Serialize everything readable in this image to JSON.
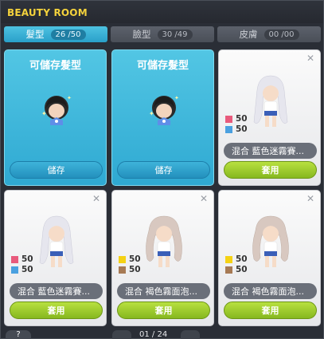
{
  "window": {
    "title": "BEAUTY ROOM"
  },
  "tabs": [
    {
      "label": "髮型",
      "count": "26 /50"
    },
    {
      "label": "臉型",
      "count": "30 /49"
    },
    {
      "label": "皮膚",
      "count": "00 /00"
    }
  ],
  "slots": [
    {
      "type": "save",
      "label": "可儲存髮型",
      "button": "儲存"
    },
    {
      "type": "save",
      "label": "可儲存髮型",
      "button": "儲存"
    },
    {
      "type": "style",
      "name": "混合  藍色迷霧賽...",
      "mix1": "50",
      "mix2": "50",
      "color1": "#e85a7c",
      "color2": "#4aa0e0",
      "hair": "#e6e6ee",
      "button": "套用"
    },
    {
      "type": "style",
      "name": "混合  藍色迷霧賽...",
      "mix1": "50",
      "mix2": "50",
      "color1": "#e85a7c",
      "color2": "#4aa0e0",
      "hair": "#e6e6ee",
      "button": "套用"
    },
    {
      "type": "style",
      "name": "混合  褐色霧面泡...",
      "mix1": "50",
      "mix2": "50",
      "color1": "#f5d214",
      "color2": "#a77a54",
      "hair": "#d8c8c0",
      "button": "套用"
    },
    {
      "type": "style",
      "name": "混合  褐色霧面泡...",
      "mix1": "50",
      "mix2": "50",
      "color1": "#f5d214",
      "color2": "#a77a54",
      "hair": "#d8c8c0",
      "button": "套用"
    }
  ],
  "footer": {
    "help": "?",
    "page": "01 / 24"
  }
}
